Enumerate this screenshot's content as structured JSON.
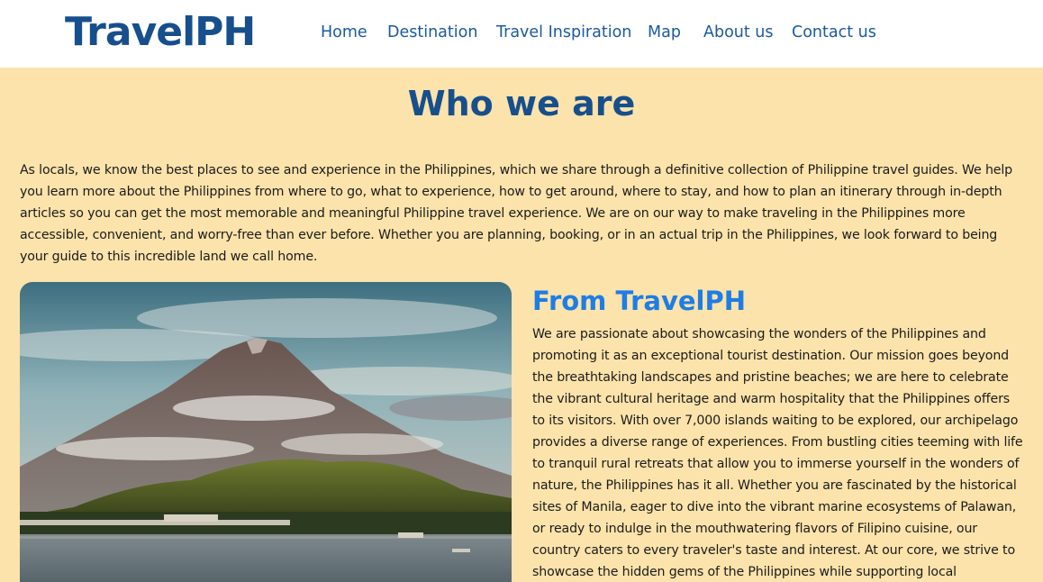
{
  "header": {
    "logo": "TravelPH",
    "nav": [
      {
        "label": "Home"
      },
      {
        "label": "Destination"
      },
      {
        "label": "Travel Inspiration"
      },
      {
        "label": "Map"
      },
      {
        "label": "About us"
      },
      {
        "label": "Contact us"
      }
    ]
  },
  "who": {
    "title": "Who we are",
    "text": "As locals, we know the best places to see and experience in the Philippines, which we share through a definitive collection of Philippine travel guides. We help you learn more about the Philippines from where to go, what to experience, how to get around, where to stay, and how to plan an itinerary through in-depth articles so you can get the most memorable and meaningful Philippine travel experience. We are on our way to make traveling in the Philippines more accessible, convenient, and worry-free than ever before. Whether you are planning, booking, or in an actual trip in the Philippines, we look forward to being your guide to this incredible land we call home."
  },
  "from": {
    "title": "From TravelPH",
    "text": "We are passionate about showcasing the wonders of the Philippines and promoting it as an exceptional tourist destination. Our mission goes beyond the breathtaking landscapes and pristine beaches; we are here to celebrate the vibrant cultural heritage and warm hospitality that the Philippines offers to its visitors. With over 7,000 islands waiting to be explored, our archipelago provides a diverse range of experiences. From bustling cities teeming with life to tranquil rural retreats that allow you to immerse yourself in the wonders of nature, the Philippines has it all. Whether you are fascinated by the historical sites of Manila, eager to dive into the vibrant marine ecosystems of Palawan, or ready to indulge in the mouthwatering flavors of Filipino cuisine, our country caters to every traveler's taste and interest. At our core, we strive to showcase the hidden gems of the Philippines while supporting local communities and"
  },
  "colors": {
    "brand": "#174f8c",
    "nav": "#1a5aa0",
    "accent": "#1e7de6",
    "background": "#fbe3ab"
  }
}
